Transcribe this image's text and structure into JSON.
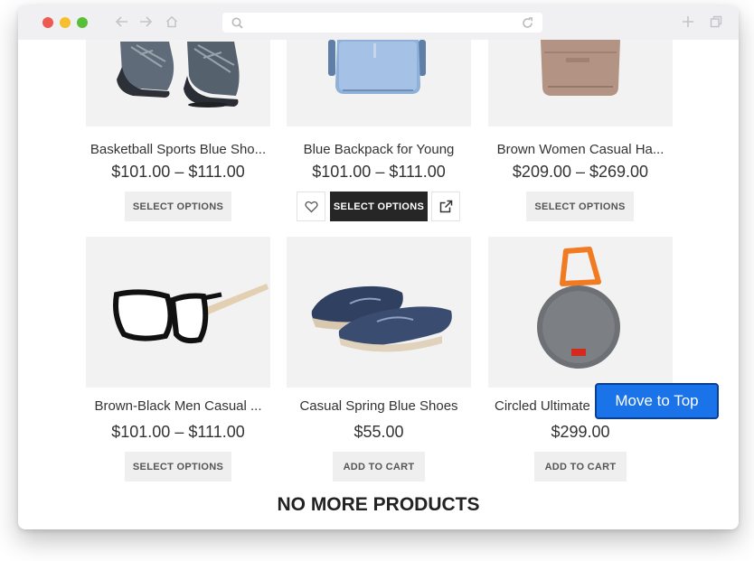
{
  "browser": {
    "address_value": "",
    "icons": [
      "back-arrow-icon",
      "forward-arrow-icon",
      "home-icon",
      "search-icon",
      "reload-icon",
      "new-tab-icon",
      "tabs-icon"
    ],
    "dot_colors": [
      "#ee5a52",
      "#f5c02c",
      "#57c038"
    ]
  },
  "products": [
    {
      "name": "Basketball Sports Blue Sho...",
      "price": "$101.00 – $111.00",
      "button": "SELECT OPTIONS",
      "image": "sneaker-image"
    },
    {
      "name": "Blue Backpack for Young",
      "price": "$101.00 – $111.00",
      "button": "SELECT OPTIONS",
      "image": "backpack-image"
    },
    {
      "name": "Brown Women Casual Ha...",
      "price": "$209.00 – $269.00",
      "button": "SELECT OPTIONS",
      "image": "handbag-image"
    },
    {
      "name": "Brown-Black Men Casual ...",
      "price": "$101.00 – $111.00",
      "button": "SELECT OPTIONS",
      "image": "glasses-image"
    },
    {
      "name": "Casual Spring Blue Shoes",
      "price": "$55.00",
      "button": "ADD TO CART",
      "image": "loafers-image"
    },
    {
      "name": "Circled Ultimate",
      "price": "$299.00",
      "button": "ADD TO CART",
      "image": "speaker-image"
    }
  ],
  "hover_actions": {
    "wishlist_icon": "heart-icon",
    "quickview_icon": "external-link-icon"
  },
  "footer": {
    "no_more": "NO MORE PRODUCTS"
  },
  "move_to_top": "Move to Top",
  "colors": {
    "dark_button": "#262626",
    "move_top_bg": "#1a73e8",
    "image_bg": "#f2f2f2"
  }
}
